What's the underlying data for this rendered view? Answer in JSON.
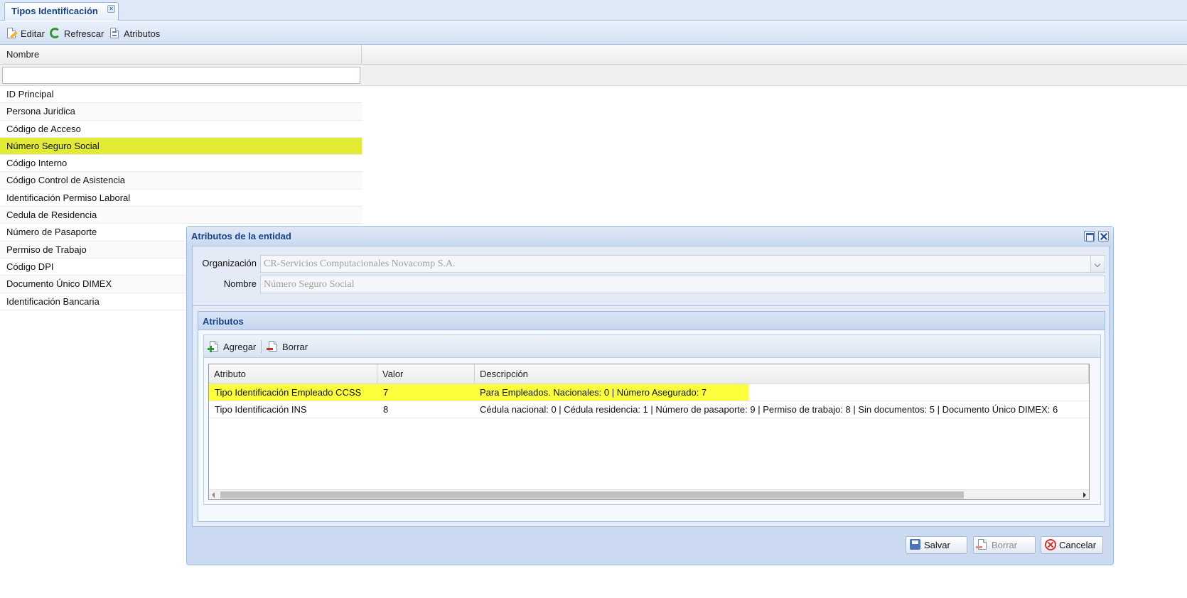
{
  "tab": {
    "title": "Tipos Identificación",
    "close": "×"
  },
  "toolbar": {
    "edit_label": "Editar",
    "refresh_label": "Refrescar",
    "attributes_label": "Atributos"
  },
  "list": {
    "column_header": "Nombre",
    "filter_value": "",
    "selected_index": 3,
    "items": [
      "ID Principal",
      "Persona Juridica",
      "Código de Acceso",
      "Número Seguro Social",
      "Código Interno",
      "Código Control de Asistencia",
      "Identificación Permiso Laboral",
      "Cedula de Residencia",
      "Número de Pasaporte",
      "Permiso de Trabajo",
      "Código DPI",
      "Documento Único DIMEX",
      "Identificación Bancaria"
    ]
  },
  "window": {
    "title": "Atributos de la entidad",
    "organization_label": "Organización",
    "organization_value": "CR-Servicios Computacionales Novacomp S.A.",
    "name_label": "Nombre",
    "name_value": "Número Seguro Social",
    "attributes_panel": {
      "title": "Atributos",
      "add_label": "Agregar",
      "delete_label": "Borrar",
      "columns": [
        "Atributo",
        "Valor",
        "Descripción"
      ],
      "rows": [
        {
          "attribute": "Tipo Identificación Empleado CCSS",
          "value": "7",
          "description": "Para Empleados. Nacionales: 0 | Número Asegurado: 7"
        },
        {
          "attribute": "Tipo Identificación INS",
          "value": "8",
          "description": "Cédula nacional: 0 | Cédula residencia: 1 | Número de pasaporte: 9 | Permiso de trabajo: 8 | Sin documentos: 5 | Documento Único DIMEX: 6"
        }
      ]
    },
    "buttons": {
      "save": "Salvar",
      "delete": "Borrar",
      "cancel": "Cancelar"
    }
  },
  "colors": {
    "selected_row": "#e1ea35",
    "highlight_row": "#fbff3c",
    "title_blue": "#15428b",
    "panel_border": "#99bbe8"
  }
}
